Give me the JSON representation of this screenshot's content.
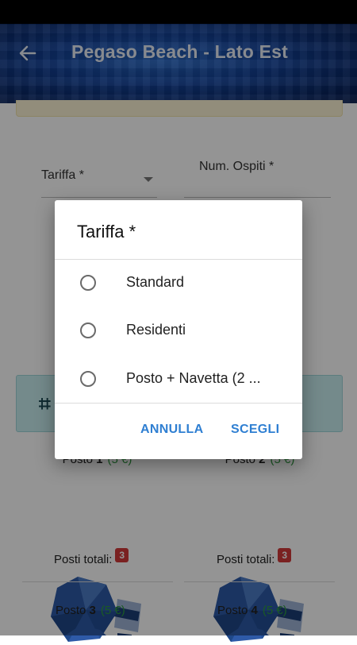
{
  "appbar": {
    "title": "Pegaso Beach - Lato Est"
  },
  "form": {
    "tariffa_label": "Tariffa *",
    "ospiti_label": "Num. Ospiti *"
  },
  "cards": [
    {
      "posto_label": "Posto",
      "number": "1",
      "price": "(5 €)",
      "totals_label": "Posti totali:",
      "count": "3"
    },
    {
      "posto_label": "Posto",
      "number": "2",
      "price": "(5 €)",
      "totals_label": "Posti totali:",
      "count": "3"
    },
    {
      "posto_label": "Posto",
      "number": "3",
      "price": "(5 €)"
    },
    {
      "posto_label": "Posto",
      "number": "4",
      "price": "(5 €)"
    }
  ],
  "dialog": {
    "title": "Tariffa *",
    "options": [
      "Standard",
      "Residenti",
      "Posto + Navetta (2 ..."
    ],
    "cancel_label": "ANNULLA",
    "confirm_label": "SCEGLI"
  },
  "colors": {
    "accent": "#2f7fd2",
    "badge": "#d23a3a",
    "price": "#2e9c3f"
  }
}
